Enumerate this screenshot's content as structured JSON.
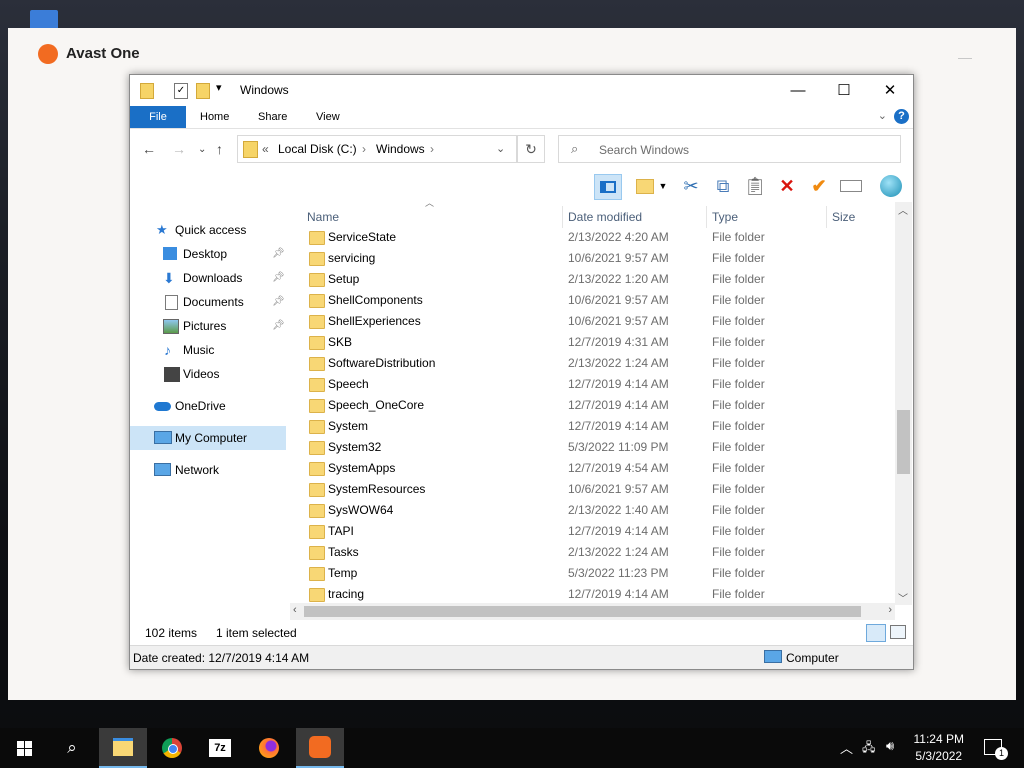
{
  "avast": {
    "title": "Avast One"
  },
  "explorer": {
    "title": "Windows",
    "ribbon_tabs": [
      "File",
      "Home",
      "Share",
      "View"
    ],
    "address": {
      "overflow": "«",
      "crumbs": [
        "Local Disk (C:)",
        "Windows"
      ]
    },
    "search": {
      "placeholder": "Search Windows"
    },
    "nav_pane": {
      "quick_access": "Quick access",
      "items": [
        {
          "label": "Desktop",
          "pinned": true
        },
        {
          "label": "Downloads",
          "pinned": true
        },
        {
          "label": "Documents",
          "pinned": true
        },
        {
          "label": "Pictures",
          "pinned": true
        },
        {
          "label": "Music",
          "pinned": false
        },
        {
          "label": "Videos",
          "pinned": false
        }
      ],
      "onedrive": "OneDrive",
      "my_computer": "My Computer",
      "network": "Network"
    },
    "columns": [
      "Name",
      "Date modified",
      "Type",
      "Size"
    ],
    "files": [
      {
        "name": "ServiceState",
        "date": "2/13/2022 4:20 AM",
        "type": "File folder"
      },
      {
        "name": "servicing",
        "date": "10/6/2021 9:57 AM",
        "type": "File folder"
      },
      {
        "name": "Setup",
        "date": "2/13/2022 1:20 AM",
        "type": "File folder"
      },
      {
        "name": "ShellComponents",
        "date": "10/6/2021 9:57 AM",
        "type": "File folder"
      },
      {
        "name": "ShellExperiences",
        "date": "10/6/2021 9:57 AM",
        "type": "File folder"
      },
      {
        "name": "SKB",
        "date": "12/7/2019 4:31 AM",
        "type": "File folder"
      },
      {
        "name": "SoftwareDistribution",
        "date": "2/13/2022 1:24 AM",
        "type": "File folder"
      },
      {
        "name": "Speech",
        "date": "12/7/2019 4:14 AM",
        "type": "File folder"
      },
      {
        "name": "Speech_OneCore",
        "date": "12/7/2019 4:14 AM",
        "type": "File folder"
      },
      {
        "name": "System",
        "date": "12/7/2019 4:14 AM",
        "type": "File folder"
      },
      {
        "name": "System32",
        "date": "5/3/2022 11:09 PM",
        "type": "File folder"
      },
      {
        "name": "SystemApps",
        "date": "12/7/2019 4:54 AM",
        "type": "File folder"
      },
      {
        "name": "SystemResources",
        "date": "10/6/2021 9:57 AM",
        "type": "File folder"
      },
      {
        "name": "SysWOW64",
        "date": "2/13/2022 1:40 AM",
        "type": "File folder"
      },
      {
        "name": "TAPI",
        "date": "12/7/2019 4:14 AM",
        "type": "File folder"
      },
      {
        "name": "Tasks",
        "date": "2/13/2022 1:24 AM",
        "type": "File folder"
      },
      {
        "name": "Temp",
        "date": "5/3/2022 11:23 PM",
        "type": "File folder"
      },
      {
        "name": "tracing",
        "date": "12/7/2019 4:14 AM",
        "type": "File folder"
      }
    ],
    "status": {
      "item_count": "102 items",
      "selected": "1 item selected"
    },
    "details": {
      "created": "Date created: 12/7/2019 4:14 AM",
      "location": "Computer"
    }
  },
  "taskbar": {
    "apps": [
      "start-icon",
      "search-icon",
      "file-explorer-icon",
      "chrome-icon",
      "7zip-icon",
      "firefox-icon",
      "avast-icon"
    ],
    "clock": {
      "time": "11:24 PM",
      "date": "5/3/2022"
    },
    "notifications": "1"
  },
  "colors": {
    "accent": "#1a6fc6",
    "avast": "#f26b21",
    "selection": "#cce4f7"
  }
}
